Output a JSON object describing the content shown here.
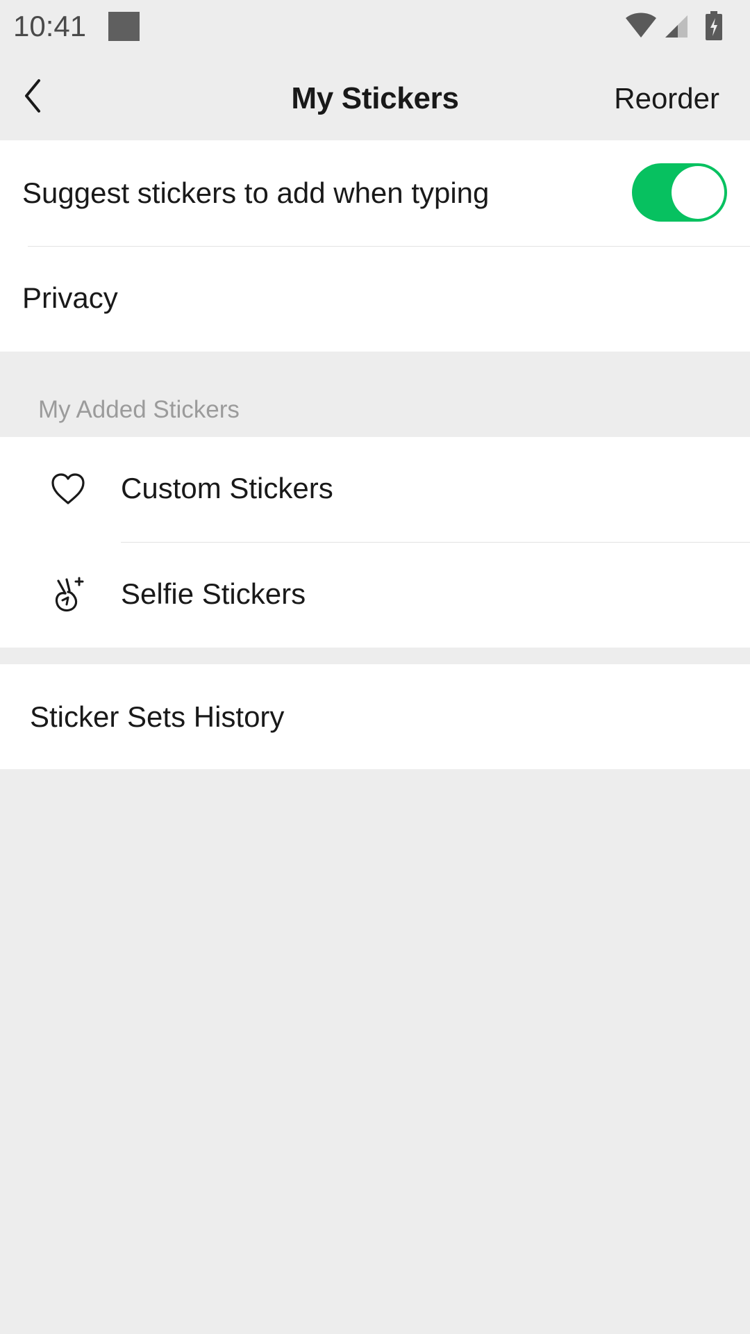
{
  "status_bar": {
    "time": "10:41",
    "icons": [
      "wifi-icon",
      "signal-icon",
      "battery-charging-icon"
    ]
  },
  "nav": {
    "title": "My Stickers",
    "reorder_label": "Reorder",
    "back_icon": "chevron-left-icon"
  },
  "settings": {
    "suggest_label": "Suggest stickers to add when typing",
    "suggest_enabled": true,
    "privacy_label": "Privacy"
  },
  "added_section": {
    "header": "My Added Stickers",
    "items": [
      {
        "label": "Custom Stickers",
        "icon": "heart-icon"
      },
      {
        "label": "Selfie Stickers",
        "icon": "selfie-hand-icon"
      }
    ]
  },
  "history": {
    "label": "Sticker Sets History"
  },
  "colors": {
    "toggle_on": "#07C160",
    "background": "#EDEDED",
    "section_header_text": "#9B9B9B"
  }
}
